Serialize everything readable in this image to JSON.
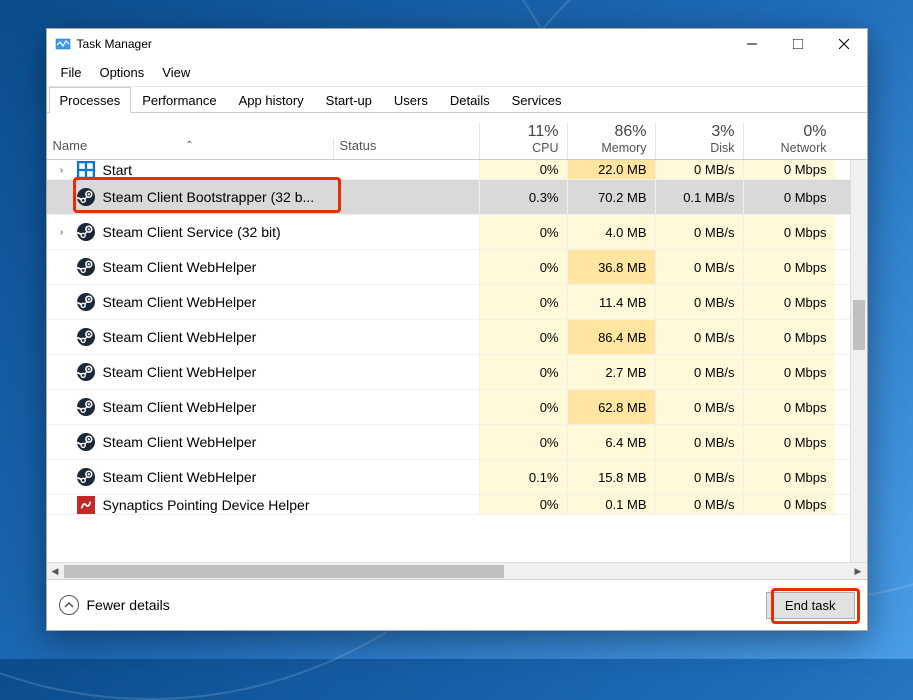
{
  "window": {
    "title": "Task Manager"
  },
  "menu": [
    "File",
    "Options",
    "View"
  ],
  "tabs": [
    "Processes",
    "Performance",
    "App history",
    "Start-up",
    "Users",
    "Details",
    "Services"
  ],
  "active_tab": 0,
  "columns": {
    "name": "Name",
    "status": "Status",
    "metrics": [
      {
        "pct": "11%",
        "label": "CPU"
      },
      {
        "pct": "86%",
        "label": "Memory"
      },
      {
        "pct": "3%",
        "label": "Disk"
      },
      {
        "pct": "0%",
        "label": "Network"
      }
    ]
  },
  "processes": [
    {
      "expand": ">",
      "icon": "start",
      "name": "Start",
      "cpu": "0%",
      "mem": "22.0 MB",
      "disk": "0 MB/s",
      "net": "0 Mbps",
      "selected": false,
      "memHot": true,
      "cut": true
    },
    {
      "expand": "",
      "icon": "steam",
      "name": "Steam Client Bootstrapper (32 b...",
      "cpu": "0.3%",
      "mem": "70.2 MB",
      "disk": "0.1 MB/s",
      "net": "0 Mbps",
      "selected": true,
      "memHot": true,
      "annotated": true
    },
    {
      "expand": ">",
      "icon": "steam",
      "name": "Steam Client Service (32 bit)",
      "cpu": "0%",
      "mem": "4.0 MB",
      "disk": "0 MB/s",
      "net": "0 Mbps",
      "selected": false
    },
    {
      "expand": "",
      "icon": "steam",
      "name": "Steam Client WebHelper",
      "cpu": "0%",
      "mem": "36.8 MB",
      "disk": "0 MB/s",
      "net": "0 Mbps",
      "selected": false,
      "memHot": true
    },
    {
      "expand": "",
      "icon": "steam",
      "name": "Steam Client WebHelper",
      "cpu": "0%",
      "mem": "11.4 MB",
      "disk": "0 MB/s",
      "net": "0 Mbps",
      "selected": false
    },
    {
      "expand": "",
      "icon": "steam",
      "name": "Steam Client WebHelper",
      "cpu": "0%",
      "mem": "86.4 MB",
      "disk": "0 MB/s",
      "net": "0 Mbps",
      "selected": false,
      "memHot": true
    },
    {
      "expand": "",
      "icon": "steam",
      "name": "Steam Client WebHelper",
      "cpu": "0%",
      "mem": "2.7 MB",
      "disk": "0 MB/s",
      "net": "0 Mbps",
      "selected": false
    },
    {
      "expand": "",
      "icon": "steam",
      "name": "Steam Client WebHelper",
      "cpu": "0%",
      "mem": "62.8 MB",
      "disk": "0 MB/s",
      "net": "0 Mbps",
      "selected": false,
      "memHot": true
    },
    {
      "expand": "",
      "icon": "steam",
      "name": "Steam Client WebHelper",
      "cpu": "0%",
      "mem": "6.4 MB",
      "disk": "0 MB/s",
      "net": "0 Mbps",
      "selected": false
    },
    {
      "expand": "",
      "icon": "steam",
      "name": "Steam Client WebHelper",
      "cpu": "0.1%",
      "mem": "15.8 MB",
      "disk": "0 MB/s",
      "net": "0 Mbps",
      "selected": false
    },
    {
      "expand": "",
      "icon": "synaptics",
      "name": "Synaptics Pointing Device Helper",
      "cpu": "0%",
      "mem": "0.1 MB",
      "disk": "0 MB/s",
      "net": "0 Mbps",
      "selected": false,
      "cutBottom": true
    }
  ],
  "footer": {
    "details_label": "Fewer details",
    "end_task": "End task"
  }
}
